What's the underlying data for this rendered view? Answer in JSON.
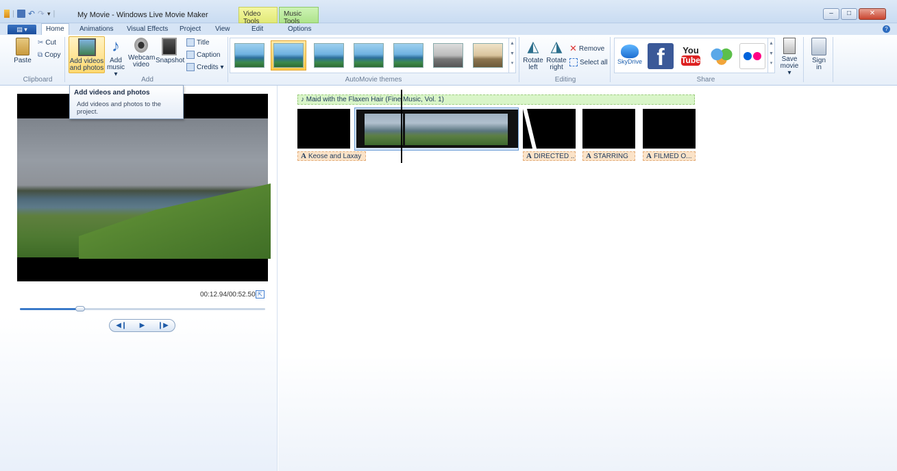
{
  "window": {
    "title": "My Movie - Windows Live Movie Maker",
    "context_tabs": [
      "Video Tools",
      "Music Tools"
    ],
    "controls": [
      "–",
      "□",
      "✕"
    ]
  },
  "tabs": [
    {
      "label": "Home",
      "active": true
    },
    {
      "label": "Animations"
    },
    {
      "label": "Visual Effects"
    },
    {
      "label": "Project"
    },
    {
      "label": "View"
    },
    {
      "label": "Edit"
    },
    {
      "label": "Options"
    }
  ],
  "app_button_label": "▤ ▾",
  "ribbon": {
    "clipboard": {
      "group": "Clipboard",
      "paste": "Paste",
      "cut": "Cut",
      "copy": "Copy"
    },
    "add": {
      "group": "Add",
      "add_videos": [
        "Add videos",
        "and photos"
      ],
      "add_music": [
        "Add",
        "music ▾"
      ],
      "webcam": [
        "Webcam",
        "video"
      ],
      "snapshot": "Snapshot",
      "title": "Title",
      "caption": "Caption",
      "credits": "Credits ▾"
    },
    "themes": {
      "group": "AutoMovie themes",
      "count": 7,
      "selected_index": 1
    },
    "editing": {
      "group": "Editing",
      "rotate_left": [
        "Rotate",
        "left"
      ],
      "rotate_right": [
        "Rotate",
        "right"
      ],
      "remove": "Remove",
      "select_all": "Select all"
    },
    "share": {
      "group": "Share",
      "skydrive": "SkyDrive",
      "facebook": "f",
      "youtube": [
        "You",
        "Tube"
      ],
      "save_movie": [
        "Save",
        "movie ▾"
      ],
      "sign_in": [
        "Sign",
        "in"
      ]
    }
  },
  "tooltip": {
    "title": "Add videos and photos",
    "body": "Add videos and photos to the project."
  },
  "preview": {
    "timecode": "00:12.94/00:52.50",
    "progress": 0.2465
  },
  "storyboard": {
    "music_track": "Maid with the Flaxen Hair (Fine Music, Vol. 1)",
    "captions": [
      "Keose and Laxay",
      "DIRECTED ...",
      "STARRING",
      "FILMED O..."
    ]
  }
}
